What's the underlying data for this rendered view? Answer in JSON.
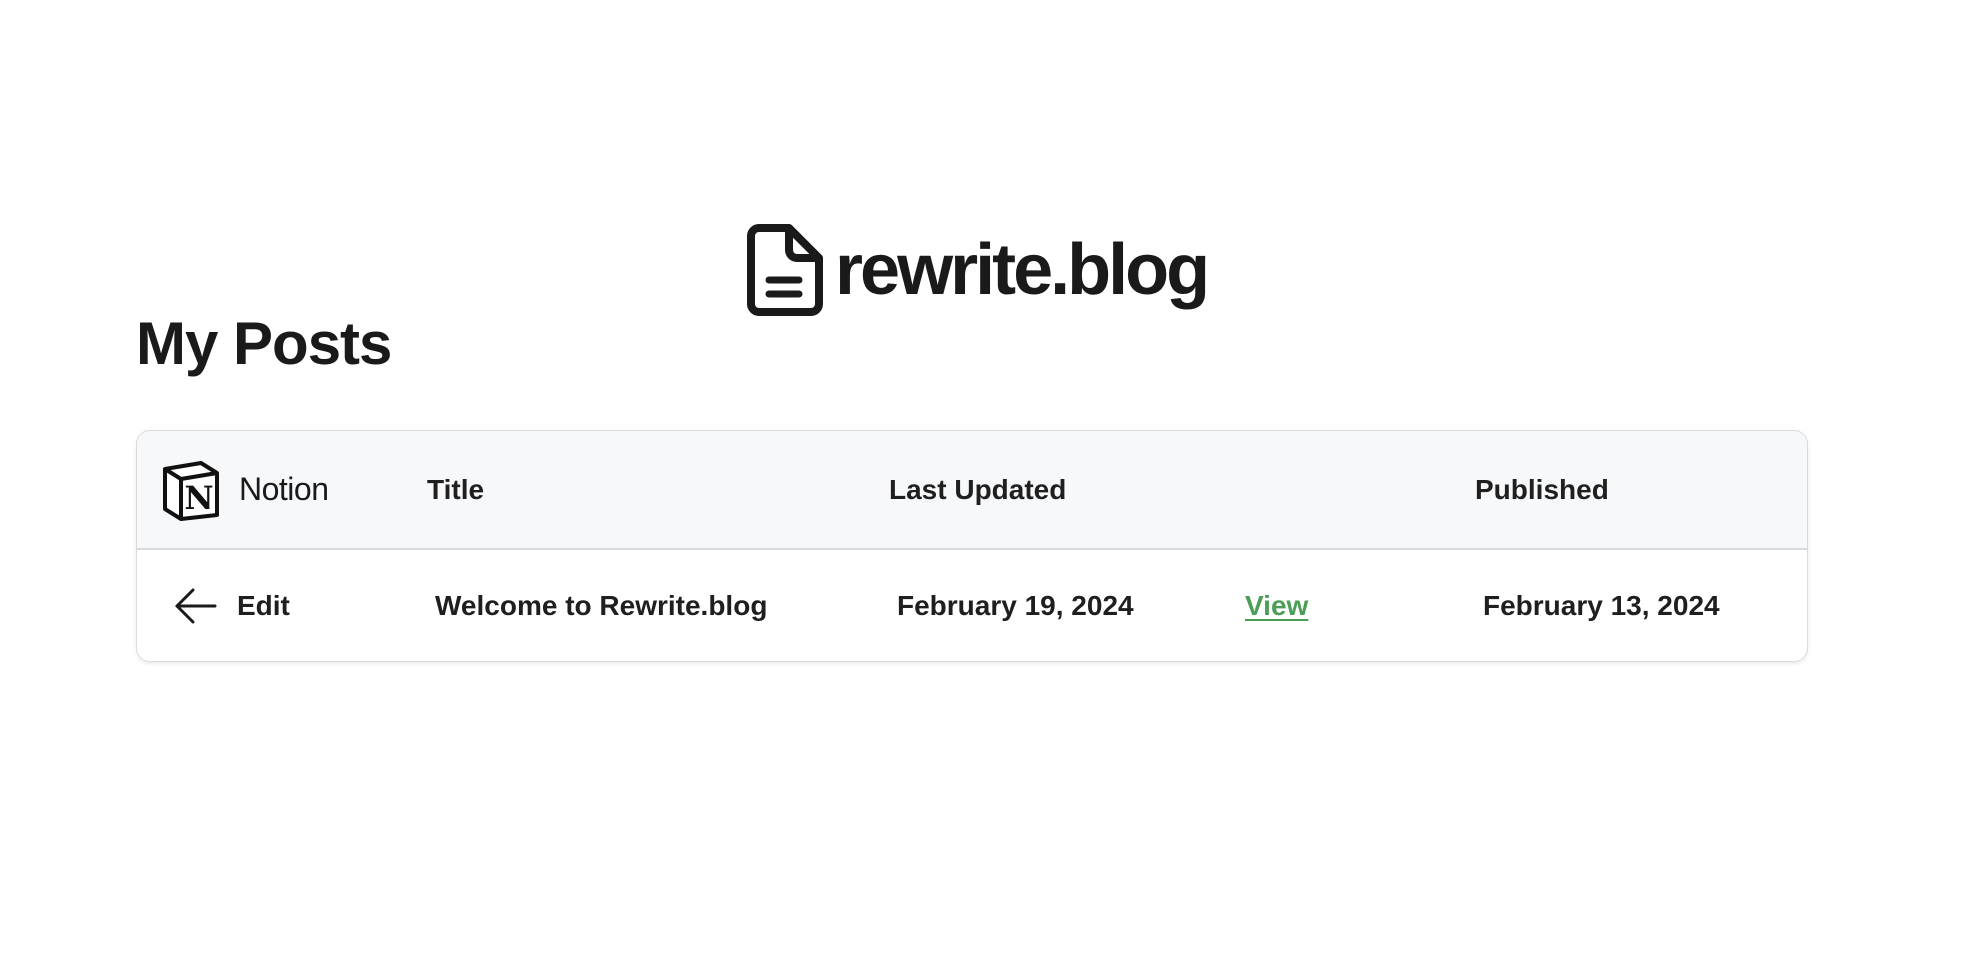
{
  "brand": {
    "icon": "document-icon",
    "name": "rewrite.blog"
  },
  "page_title": "My Posts",
  "table": {
    "header": {
      "notion_icon": "notion-logo-icon",
      "notion_label": "Notion",
      "title": "Title",
      "last_updated": "Last Updated",
      "published": "Published"
    },
    "rows": [
      {
        "edit_icon": "arrow-left-icon",
        "edit_label": "Edit",
        "title": "Welcome to Rewrite.blog",
        "last_updated": "February 19, 2024",
        "view_label": "View",
        "published": "February 13, 2024"
      }
    ]
  },
  "colors": {
    "text": "#1a1a1a",
    "header_bg": "#f7f8fa",
    "border": "#d8dadd",
    "link": "#4a9e55",
    "background": "#ffffff"
  }
}
